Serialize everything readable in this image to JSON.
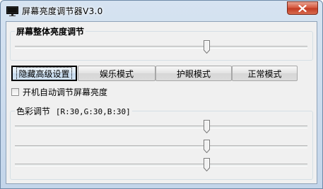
{
  "window": {
    "title": "屏幕亮度调节器V3.0"
  },
  "brightness_group": {
    "label": "屏幕整体亮度调节",
    "slider_value_fraction": 0.66
  },
  "modes": [
    {
      "label": "隐藏高级设置",
      "active": true
    },
    {
      "label": "娱乐模式",
      "active": false
    },
    {
      "label": "护眼模式",
      "active": false
    },
    {
      "label": "正常模式",
      "active": false
    }
  ],
  "autostart": {
    "label": "开机自动调节屏幕亮度",
    "checked": false
  },
  "color_group": {
    "label": "色彩调节",
    "readout": "[R:30,G:30,B:30]",
    "sliders": [
      {
        "channel": "R",
        "value_fraction": 0.66
      },
      {
        "channel": "G",
        "value_fraction": 0.66
      },
      {
        "channel": "B",
        "value_fraction": 0.66
      }
    ]
  },
  "colors": {
    "titlebar": "#c8d9ec",
    "close_button": "#c8442b",
    "client_bg": "#f0f0f0"
  }
}
